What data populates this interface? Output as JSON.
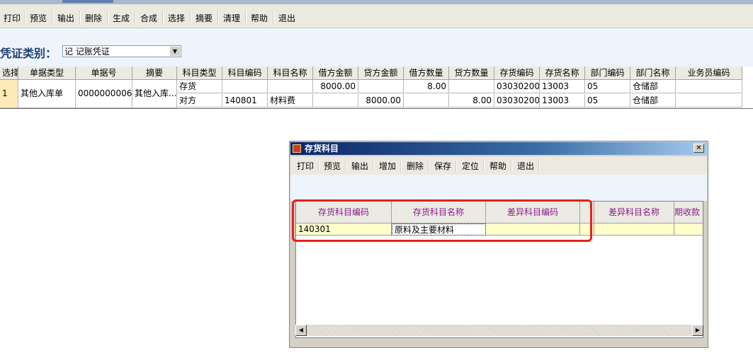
{
  "toolbar": {
    "buttons": [
      "打印",
      "预览",
      "输出",
      "删除",
      "生成",
      "合成",
      "选择",
      "摘要",
      "清理",
      "帮助",
      "退出"
    ]
  },
  "header": {
    "voucher_type_label": "凭证类别：",
    "voucher_type_value": "记 记账凭证"
  },
  "grid": {
    "columns": [
      "选择",
      "单据类型",
      "单据号",
      "摘要",
      "科目类型",
      "科目编码",
      "科目名称",
      "借方金额",
      "贷方金额",
      "借方数量",
      "贷方数量",
      "存货编码",
      "存货名称",
      "部门编码",
      "部门名称",
      "业务员编码"
    ],
    "merged": {
      "select": "1",
      "doc_type": "其他入库单",
      "doc_no": "0000000006",
      "summary": "其他入库..."
    },
    "rows": [
      {
        "subject_type": "存货",
        "subject_code": "",
        "subject_name": "",
        "debit_amount": "8000.00",
        "credit_amount": "",
        "debit_qty": "8.00",
        "credit_qty": "",
        "inv_code": "03030200...",
        "inv_name": "13003",
        "dept_code": "05",
        "dept_name": "仓储部",
        "salesman": ""
      },
      {
        "subject_type": "对方",
        "subject_code": "140801",
        "subject_name": "材料费",
        "debit_amount": "",
        "credit_amount": "8000.00",
        "debit_qty": "",
        "credit_qty": "8.00",
        "inv_code": "03030200...",
        "inv_name": "13003",
        "dept_code": "05",
        "dept_name": "仓储部",
        "salesman": ""
      }
    ]
  },
  "dialog": {
    "title": "存货科目",
    "close_glyph": "✕",
    "buttons": [
      "打印",
      "预览",
      "输出",
      "增加",
      "删除",
      "保存",
      "定位",
      "帮助",
      "退出"
    ],
    "columns": [
      "存货科目编码",
      "存货科目名称",
      "差异科目编码",
      "",
      "差异科目名称",
      "期收款"
    ],
    "rows": [
      [
        "140301",
        "原料及主要材料",
        "",
        "",
        "",
        ""
      ]
    ]
  },
  "colors": {
    "highlight": "#e8201c",
    "title_blue": "#0a246a",
    "row_yellow": "#ffffcc",
    "header_text": "#8b1a8b"
  }
}
